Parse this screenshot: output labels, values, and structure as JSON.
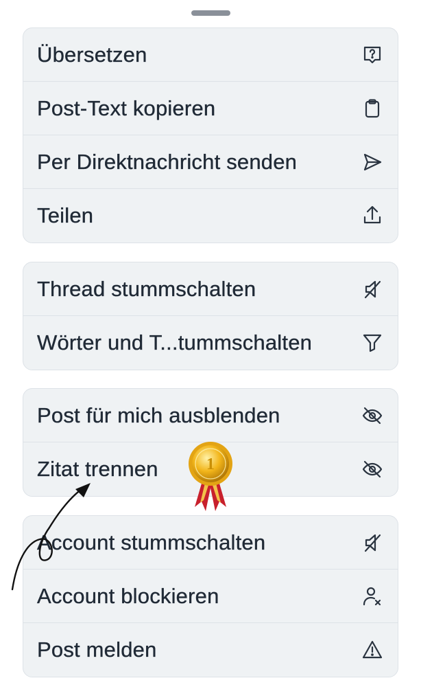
{
  "groups": [
    {
      "items": [
        {
          "label": "Übersetzen",
          "icon": "translate-icon"
        },
        {
          "label": "Post-Text kopieren",
          "icon": "clipboard-icon"
        },
        {
          "label": "Per Direktnachricht senden",
          "icon": "send-icon"
        },
        {
          "label": "Teilen",
          "icon": "share-icon"
        }
      ]
    },
    {
      "items": [
        {
          "label": "Thread stummschalten",
          "icon": "mute-icon"
        },
        {
          "label": "Wörter und T...tummschalten",
          "icon": "filter-icon"
        }
      ]
    },
    {
      "items": [
        {
          "label": "Post für mich ausblenden",
          "icon": "eye-slash-icon"
        },
        {
          "label": "Zitat trennen",
          "icon": "eye-slash-icon"
        }
      ]
    },
    {
      "items": [
        {
          "label": "Account stummschalten",
          "icon": "mute-icon"
        },
        {
          "label": "Account blockieren",
          "icon": "person-x-icon"
        },
        {
          "label": "Post melden",
          "icon": "warning-icon"
        }
      ]
    }
  ],
  "medal": {
    "number": "1",
    "gold": "#f2b51a",
    "ribbon": "#c8202c"
  },
  "colors": {
    "group_bg": "#eff2f4",
    "text": "#202a36",
    "handle": "#8a9099"
  }
}
